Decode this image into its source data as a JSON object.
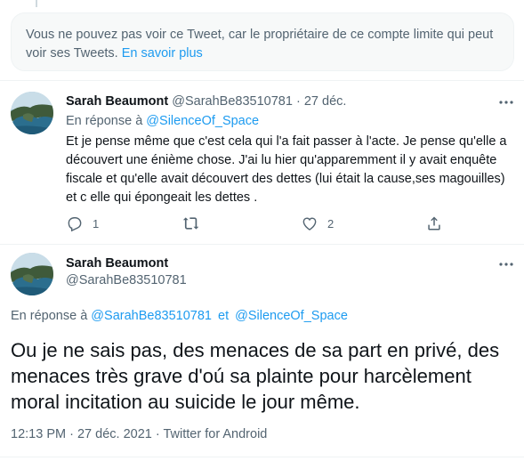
{
  "notice": {
    "text": "Vous ne pouvez pas voir ce Tweet, car le propriétaire de ce compte limite qui peut voir ses Tweets.",
    "link": "En savoir plus"
  },
  "reply_tweet": {
    "author_name": "Sarah Beaumont",
    "author_handle": "@SarahBe83510781",
    "separator": "·",
    "date": "27 déc.",
    "reply_prefix": "En réponse à",
    "reply_to": "@SilenceOf_Space",
    "body": "Et je pense même que c'est cela qui l'a fait passer à l'acte. Je pense qu'elle a découvert une énième chose. J'ai lu hier qu'apparemment il y avait enquête fiscale et qu'elle avait découvert des dettes (lui était la cause,ses magouilles) et c elle qui épongeait les dettes .",
    "actions": {
      "reply_count": "1",
      "retweet_count": "",
      "like_count": "2"
    },
    "icons": [
      "reply-icon",
      "retweet-icon",
      "like-icon",
      "share-icon",
      "more-icon"
    ]
  },
  "main_tweet": {
    "author_name": "Sarah Beaumont",
    "author_handle": "@SarahBe83510781",
    "reply_prefix": "En réponse à",
    "reply_to_1": "@SarahBe83510781",
    "reply_join": "et",
    "reply_to_2": "@SilenceOf_Space",
    "body": "Ou je ne sais pas, des menaces de sa part en privé, des menaces très grave d'oú sa plainte pour harcèlement moral incitation au suicide le jour même.",
    "time": "12:13 PM",
    "separator": "·",
    "date": "27 déc. 2021",
    "source": "Twitter for Android"
  },
  "colors": {
    "accent": "#1d9bf0",
    "muted": "#536471",
    "text": "#0f1419",
    "border": "#eff3f4"
  }
}
